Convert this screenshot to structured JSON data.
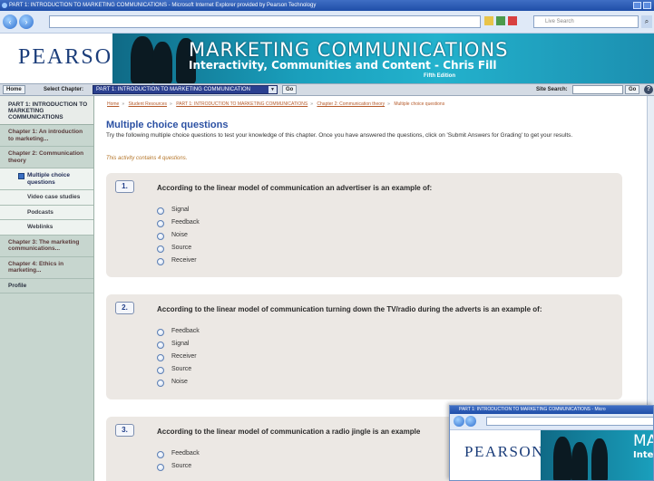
{
  "browser": {
    "title": "PART 1: INTRODUCTION TO MARKETING COMMUNICATIONS - Microsoft Internet Explorer provided by Pearson Technology",
    "search_placeholder": "Live Search"
  },
  "banner": {
    "logo": "PEARSON",
    "title": "MARKETING COMMUNICATIONS",
    "subtitle": "Interactivity, Communities and Content - Chris Fill",
    "edition": "Fifth Edition"
  },
  "chapterbar": {
    "home": "Home",
    "select_label": "Select Chapter:",
    "selected": "PART 1: INTRODUCTION TO MARKETING COMMUNICATION",
    "go": "Go",
    "site_search_label": "Site Search:",
    "search_go": "Go",
    "help": "?"
  },
  "sidebar": {
    "part": "PART 1: INTRODUCTION TO MARKETING COMMUNICATIONS",
    "items": [
      {
        "label": "Chapter 1: An introduction to marketing..."
      },
      {
        "label": "Chapter 2: Communication theory"
      },
      {
        "label": "Multiple choice questions"
      },
      {
        "label": "Video case studies"
      },
      {
        "label": "Podcasts"
      },
      {
        "label": "Weblinks"
      },
      {
        "label": "Chapter 3: The marketing communications..."
      },
      {
        "label": "Chapter 4: Ethics in marketing..."
      },
      {
        "label": "Profile"
      }
    ]
  },
  "breadcrumb": [
    "Home",
    "Student Resources",
    "PART 1: INTRODUCTION TO MARKETING COMMUNICATIONS",
    "Chapter 2: Communication theory",
    "Multiple choice questions"
  ],
  "page": {
    "title": "Multiple choice questions",
    "intro": "Try the following multiple choice questions to test your knowledge of this chapter. Once you have answered the questions, click on 'Submit Answers for Grading' to get your results.",
    "count_note": "This activity contains 4 questions."
  },
  "questions": [
    {
      "number": "1.",
      "text": "According to the linear model of communication an advertiser is an example of:",
      "options": [
        "Signal",
        "Feedback",
        "Noise",
        "Source",
        "Receiver"
      ]
    },
    {
      "number": "2.",
      "text": "According to the linear model of communication turning down the TV/radio during the adverts is an example of:",
      "options": [
        "Feedback",
        "Signal",
        "Receiver",
        "Source",
        "Noise"
      ]
    },
    {
      "number": "3.",
      "text": "According to the linear model of communication a radio jingle is an example",
      "options": [
        "Feedback",
        "Source"
      ]
    }
  ],
  "popup": {
    "title": "PART 1: INTRODUCTION TO MARKETING COMMUNICATIONS - Micro",
    "logo": "PEARSON",
    "title_fragment": "MA",
    "subtitle_fragment": "Inte"
  }
}
